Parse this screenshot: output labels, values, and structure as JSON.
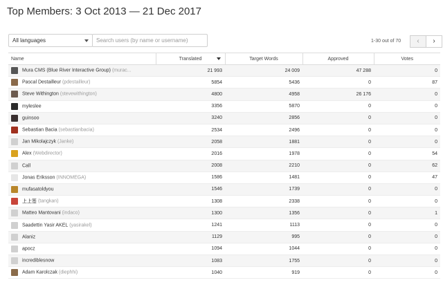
{
  "page": {
    "title": "Top Members: 3 Oct 2013 — 21 Dec 2017"
  },
  "filters": {
    "language": "All languages",
    "search_placeholder": "Search users (by name or username)"
  },
  "pager": {
    "range": "1-30 out of 70",
    "prev_icon": "‹",
    "next_icon": "›"
  },
  "table": {
    "columns": [
      "Name",
      "Translated",
      "Target Words",
      "Approved",
      "Votes"
    ],
    "sorted_column": "Translated",
    "rows": [
      {
        "name": "Mura CMS (Blue River Interactive Group)",
        "username": "(murac...",
        "avatar": "#555555",
        "translated": "21 993",
        "target_words": "24 009",
        "approved": "47 288",
        "votes": "0"
      },
      {
        "name": "Pascal Destailleur",
        "username": "(pdestailleur)",
        "avatar": "#8a6a4a",
        "translated": "5854",
        "target_words": "5436",
        "approved": "0",
        "votes": "87"
      },
      {
        "name": "Steve Withington",
        "username": "(stevewithington)",
        "avatar": "#6b5a4e",
        "translated": "4800",
        "target_words": "4958",
        "approved": "26 176",
        "votes": "0"
      },
      {
        "name": "myleslee",
        "username": "",
        "avatar": "#2b2b2b",
        "translated": "3356",
        "target_words": "5870",
        "approved": "0",
        "votes": "0"
      },
      {
        "name": "guinsoo",
        "username": "",
        "avatar": "#3a3030",
        "translated": "3240",
        "target_words": "2856",
        "approved": "0",
        "votes": "0"
      },
      {
        "name": "Sebastian Bacia",
        "username": "(sebastianbacia)",
        "avatar": "#a0301e",
        "translated": "2534",
        "target_words": "2496",
        "approved": "0",
        "votes": "0"
      },
      {
        "name": "Jan Mikolajczyk",
        "username": "(Janke)",
        "avatar": "#d0d0d0",
        "translated": "2058",
        "target_words": "1881",
        "approved": "0",
        "votes": "0"
      },
      {
        "name": "Alex",
        "username": "(Webdirector)",
        "avatar": "#d9a21f",
        "translated": "2016",
        "target_words": "1978",
        "approved": "0",
        "votes": "54"
      },
      {
        "name": "Call",
        "username": "",
        "avatar": "#d0d0d0",
        "translated": "2008",
        "target_words": "2210",
        "approved": "0",
        "votes": "62"
      },
      {
        "name": "Jonas Eriksson",
        "username": "(INNOMEGA)",
        "avatar": "#e6e6e6",
        "translated": "1586",
        "target_words": "1481",
        "approved": "0",
        "votes": "47"
      },
      {
        "name": "mufasatoldyou",
        "username": "",
        "avatar": "#b8862a",
        "translated": "1546",
        "target_words": "1739",
        "approved": "0",
        "votes": "0"
      },
      {
        "name": "上上签",
        "username": "(tangkan)",
        "avatar": "#c8453a",
        "translated": "1308",
        "target_words": "2338",
        "approved": "0",
        "votes": "0"
      },
      {
        "name": "Matteo Mantovani",
        "username": "(indaco)",
        "avatar": "#d0d0d0",
        "translated": "1300",
        "target_words": "1356",
        "approved": "0",
        "votes": "1"
      },
      {
        "name": "Saadettin Yasir AKEL",
        "username": "(yasirakel)",
        "avatar": "#d0d0d0",
        "translated": "1241",
        "target_words": "1113",
        "approved": "0",
        "votes": "0"
      },
      {
        "name": "Alaniz",
        "username": "",
        "avatar": "#d0d0d0",
        "translated": "1129",
        "target_words": "995",
        "approved": "0",
        "votes": "0"
      },
      {
        "name": "apocz",
        "username": "",
        "avatar": "#d0d0d0",
        "translated": "1094",
        "target_words": "1044",
        "approved": "0",
        "votes": "0"
      },
      {
        "name": "incrediblesnow",
        "username": "",
        "avatar": "#d0d0d0",
        "translated": "1083",
        "target_words": "1755",
        "approved": "0",
        "votes": "0"
      },
      {
        "name": "Adam Karolczak",
        "username": "(diephhi)",
        "avatar": "#8a6b4a",
        "translated": "1040",
        "target_words": "919",
        "approved": "0",
        "votes": "0"
      }
    ]
  }
}
